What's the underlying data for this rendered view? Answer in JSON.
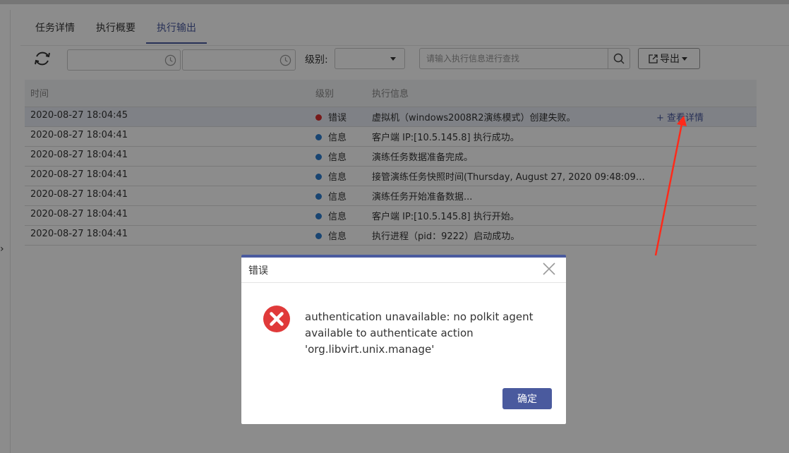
{
  "tabs": [
    {
      "label": "任务详情"
    },
    {
      "label": "执行概要"
    },
    {
      "label": "执行输出"
    }
  ],
  "active_tab": "执行输出",
  "toolbar": {
    "level_label": "级别:",
    "level_value": "",
    "search_placeholder": "请输入执行信息进行查找",
    "export_label": "导出"
  },
  "table": {
    "headers": {
      "time": "时间",
      "level": "级别",
      "message": "执行信息"
    },
    "detail_link": "+ 查看详情",
    "rows": [
      {
        "time": "2020-08-27 18:04:45",
        "level": "错误",
        "level_color": "#d93030",
        "message": "虚拟机（windows2008R2演练模式）创建失败。"
      },
      {
        "time": "2020-08-27 18:04:41",
        "level": "信息",
        "level_color": "#2f7fd0",
        "message": "客户端 IP:[10.5.145.8] 执行成功。"
      },
      {
        "time": "2020-08-27 18:04:41",
        "level": "信息",
        "level_color": "#2f7fd0",
        "message": "演练任务数据准备完成。"
      },
      {
        "time": "2020-08-27 18:04:41",
        "level": "信息",
        "level_color": "#2f7fd0",
        "message": "接管演练任务快照时间(Thursday, August 27, 2020 09:48:09…"
      },
      {
        "time": "2020-08-27 18:04:41",
        "level": "信息",
        "level_color": "#2f7fd0",
        "message": "演练任务开始准备数据..."
      },
      {
        "time": "2020-08-27 18:04:41",
        "level": "信息",
        "level_color": "#2f7fd0",
        "message": "客户端 IP:[10.5.145.8] 执行开始。"
      },
      {
        "time": "2020-08-27 18:04:41",
        "level": "信息",
        "level_color": "#2f7fd0",
        "message": "执行进程（pid：9222）启动成功。"
      }
    ]
  },
  "dialog": {
    "title": "错误",
    "message": "authentication unavailable: no polkit agent available to authenticate action 'org.libvirt.unix.manage'",
    "ok_label": "确定"
  },
  "colors": {
    "accent": "#4a5a9e",
    "error": "#d93030",
    "info": "#2f7fd0",
    "annotation_arrow": "#ff2a1a"
  },
  "left_chevron": "›"
}
